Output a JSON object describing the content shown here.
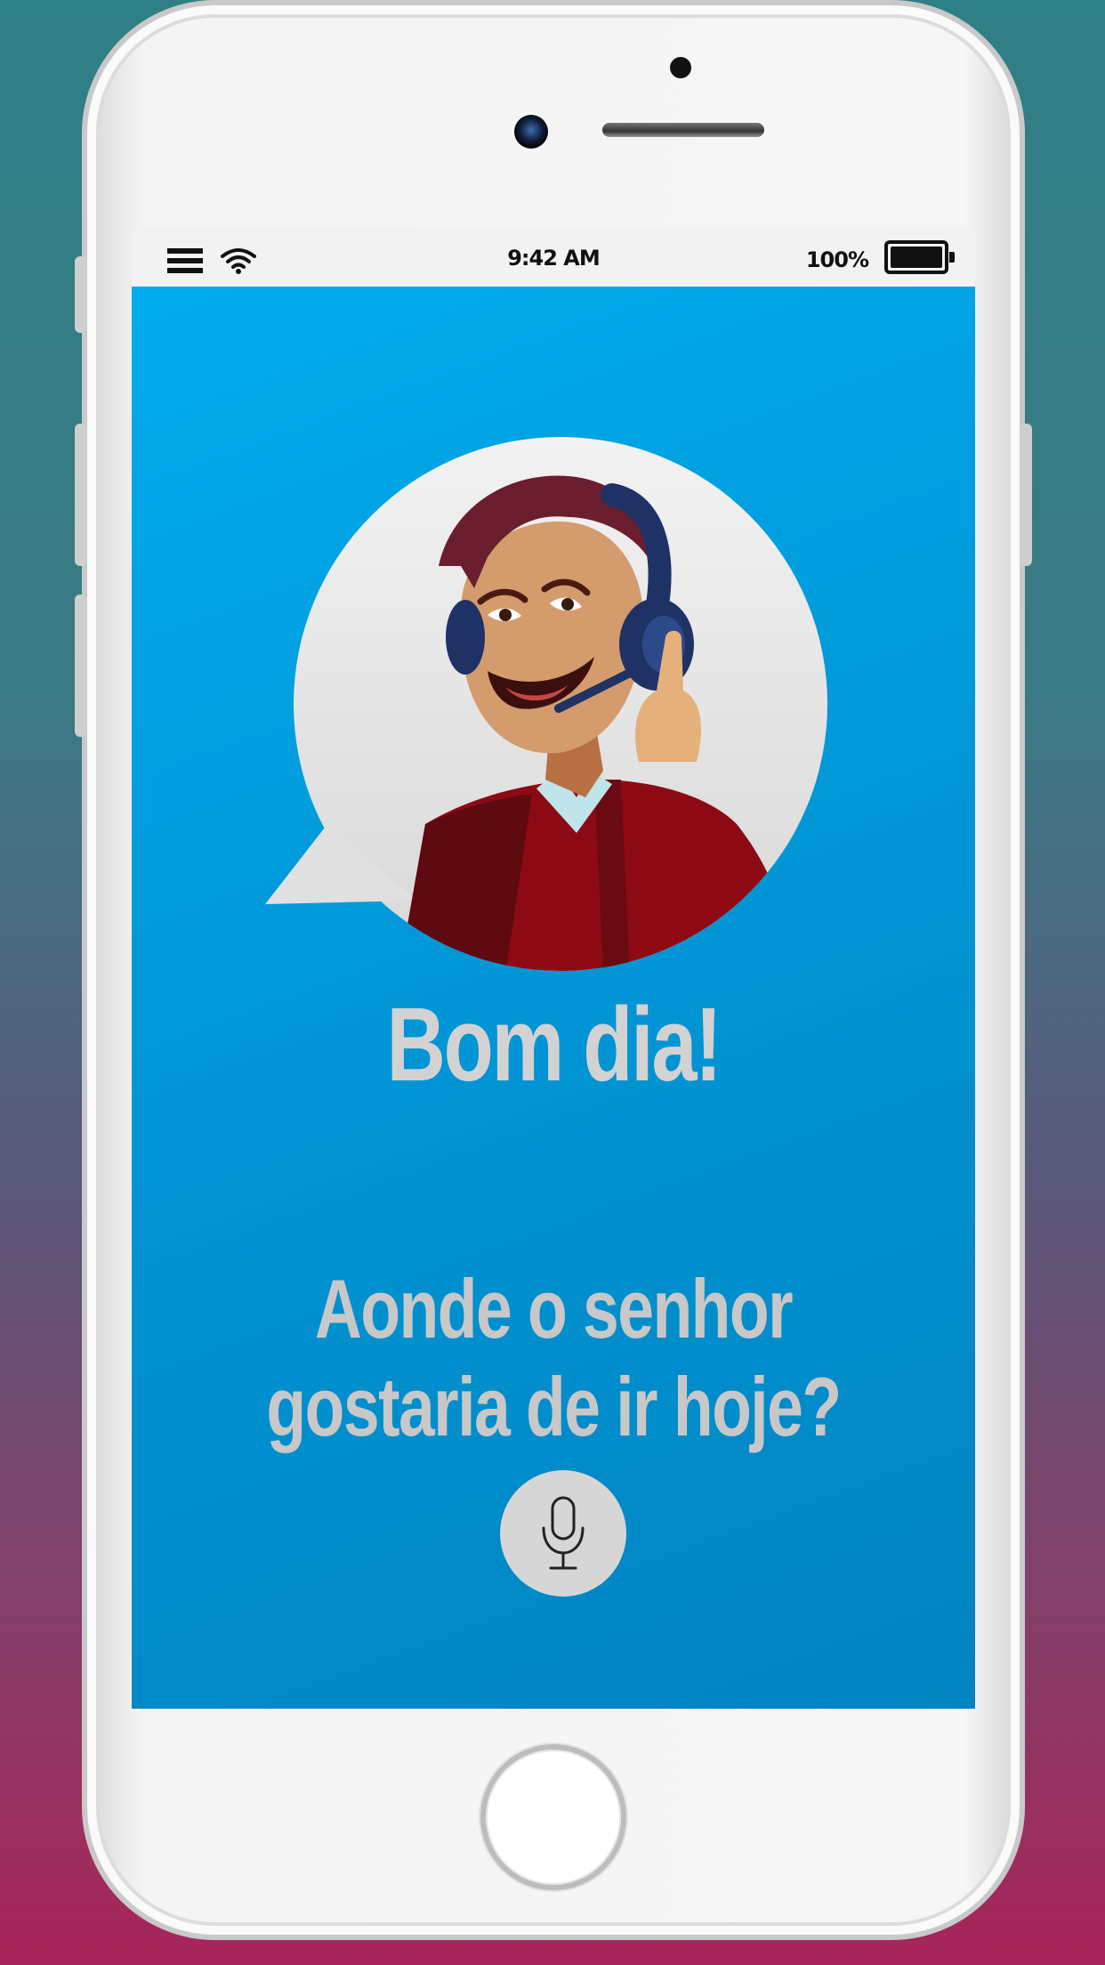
{
  "status_bar": {
    "time": "9:42 AM",
    "battery_percent": "100%",
    "battery_level": 1.0,
    "icons": [
      "menu-icon",
      "wifi-icon",
      "battery-icon"
    ]
  },
  "main": {
    "greeting": "Bom dia!",
    "question_line1": "Aonde o senhor",
    "question_line2": "gostaria de ir hoje?",
    "mic_icon": "microphone-icon"
  },
  "colors": {
    "screen_gradient_top": "#00aeef",
    "screen_gradient_bottom": "#0083c0",
    "text": "#d2d2d2",
    "mic_button": "#d6d6d6"
  }
}
